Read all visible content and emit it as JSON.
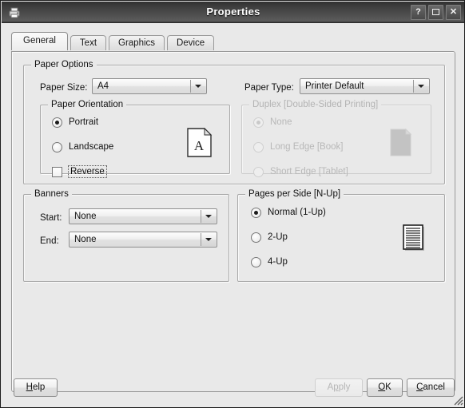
{
  "window": {
    "title": "Properties",
    "icon": "printer-icon",
    "controls": [
      {
        "name": "help-button",
        "glyph": "?"
      },
      {
        "name": "maximize-button",
        "glyph": "□"
      },
      {
        "name": "close-button",
        "glyph": "✕"
      }
    ]
  },
  "tabs": [
    {
      "label": "General",
      "active": true
    },
    {
      "label": "Text",
      "active": false
    },
    {
      "label": "Graphics",
      "active": false
    },
    {
      "label": "Device",
      "active": false
    }
  ],
  "paper_options": {
    "legend": "Paper Options",
    "paper_size": {
      "label": "Paper Size:",
      "value": "A4"
    },
    "paper_type": {
      "label": "Paper Type:",
      "value": "Printer Default"
    },
    "orientation": {
      "legend": "Paper Orientation",
      "options": [
        {
          "label": "Portrait",
          "checked": true
        },
        {
          "label": "Landscape",
          "checked": false
        }
      ],
      "reverse": {
        "label": "Reverse",
        "checked": false,
        "focused": true
      },
      "preview_icon": "portrait-page-icon",
      "preview_glyph": "A"
    },
    "duplex": {
      "legend": "Duplex [Double-Sided Printing]",
      "disabled": true,
      "options": [
        {
          "label": "None",
          "checked": true
        },
        {
          "label": "Long Edge [Book]",
          "checked": false
        },
        {
          "label": "Short Edge [Tablet]",
          "checked": false
        }
      ],
      "preview_icon": "duplex-page-icon"
    }
  },
  "banners": {
    "legend": "Banners",
    "start": {
      "label": "Start:",
      "value": "None"
    },
    "end": {
      "label": "End:",
      "value": "None"
    }
  },
  "pages_per_side": {
    "legend": "Pages per Side [N-Up]",
    "options": [
      {
        "label": "Normal (1-Up)",
        "checked": true
      },
      {
        "label": "2-Up",
        "checked": false
      },
      {
        "label": "4-Up",
        "checked": false
      }
    ],
    "preview_icon": "nup-page-icon"
  },
  "footer": {
    "help": {
      "mnemonic": "H",
      "rest": "elp"
    },
    "apply": {
      "pre": "A",
      "mnemonic": "p",
      "rest": "ply",
      "disabled": true
    },
    "ok": {
      "mnemonic": "O",
      "rest": "K"
    },
    "cancel": {
      "mnemonic": "C",
      "rest": "ancel"
    }
  },
  "colors": {
    "window_bg": "#e9e9e9",
    "titlebar": "#4b4b4b",
    "border": "#a8a8a8",
    "text": "#111111",
    "disabled_text": "#b3b3b3"
  }
}
